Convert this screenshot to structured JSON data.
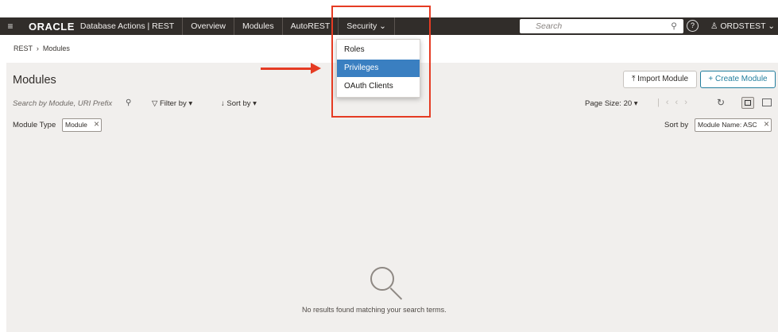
{
  "header": {
    "menu_icon": "hamburger-icon",
    "logo": "ORACLE",
    "app_title": "Database Actions | REST",
    "tabs": [
      {
        "label": "Overview"
      },
      {
        "label": "Modules"
      },
      {
        "label": "AutoREST"
      },
      {
        "label": "Security"
      }
    ],
    "search_placeholder": "Search",
    "help_icon": "help-icon",
    "user": "ORDSTEST"
  },
  "security_menu": {
    "items": [
      {
        "label": "Roles"
      },
      {
        "label": "Privileges"
      },
      {
        "label": "OAuth Clients"
      }
    ],
    "selected": "Privileges"
  },
  "breadcrumb": {
    "root": "REST",
    "current": "Modules"
  },
  "page": {
    "title": "Modules",
    "import_label": "Import Module",
    "create_label": "Create Module"
  },
  "toolbar": {
    "search_placeholder": "Search by Module, URI Prefix",
    "filter_label": "Filter by",
    "sort_label": "Sort by",
    "page_size_label": "Page Size: 20"
  },
  "filters": {
    "type_label": "Module Type",
    "type_chip": "Module",
    "sort_label": "Sort by",
    "sort_chip": "Module Name: ASC"
  },
  "empty_state": {
    "icon": "search-icon",
    "message": "No results found matching your search terms."
  },
  "annotation": {
    "color": "#e53b23"
  }
}
